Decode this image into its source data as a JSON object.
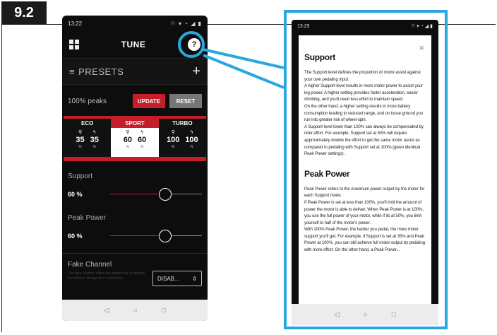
{
  "figure_label": "9.2",
  "left_phone": {
    "status_time": "13:22",
    "status_icons": "⚐ ▾ ◔ ◢ ▮",
    "header_title": "TUNE",
    "help_icon": "?",
    "presets_label": "PRESETS",
    "presets_icon": "≡",
    "add_icon": "+",
    "peaks_label": "100% peaks",
    "update_label": "UPDATE",
    "reset_label": "RESET",
    "modes": [
      {
        "name": "ECO",
        "support": "35",
        "peak": "35",
        "unit": "%"
      },
      {
        "name": "SPORT",
        "support": "60",
        "peak": "60",
        "unit": "%"
      },
      {
        "name": "TURBO",
        "support": "100",
        "peak": "100",
        "unit": "%"
      }
    ],
    "support_title": "Support",
    "support_value": "60 %",
    "support_fraction": 0.6,
    "peak_title": "Peak Power",
    "peak_value": "60 %",
    "peak_fraction": 0.6,
    "fake_title": "Fake Channel",
    "fake_desc": "The fake channel offers the opportunity to display the battery change on a connected ...",
    "fake_select": "DISAB...",
    "nav_back": "◁",
    "nav_home": "○",
    "nav_recent": "□"
  },
  "right_phone": {
    "status_time": "13:29",
    "status_icons": "⚐ ▾ ◔ ◢ ▮",
    "close_icon": "×",
    "support_heading": "Support",
    "support_p1": "The Support level defines the proportion of motor assist against your own pedaling input.",
    "support_p2": "A higher Support level results in more motor power to assist your leg power. A higher setting provides faster acceleration, easier climbing, and you'll need less effort to maintain speed.",
    "support_p3": "On the other hand, a higher setting results in more battery consumption leading to reduced range, and on loose ground you run into greater risk of wheel-spin.",
    "support_p4": "A Support level lower than 100% can always be compensated by rider effort. For example, Support set at 50% will require approximately double the effort to get the same motor assist as compared to pedaling with Support set at 100% (given identical Peak Power settings).",
    "peak_heading": "Peak Power",
    "peak_p1": "Peak Power refers to the maximum power output by the motor for each Support mode.",
    "peak_p2": "If Peak Power is set at less than 100%, you'll limit the amount of power the motor is able to deliver. When Peak Power is at 100%, you use the full power of your motor, while if its at 50%, you limit yourself to half of the motor's power.",
    "peak_p3": "With 100% Peak Power, the harder you pedal, the more motor support you'll get. For example, if Support is set at 35% and Peak Power at 100%, you can still achieve full motor output by pedaling with more effort. On the other hand, a Peak Power...",
    "nav_back": "◁",
    "nav_home": "○",
    "nav_recent": "□"
  },
  "colors": {
    "accent_red": "#c41e2a",
    "callout_blue": "#29a8df"
  }
}
